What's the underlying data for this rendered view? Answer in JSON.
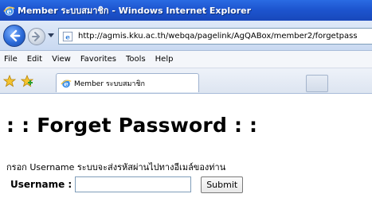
{
  "window": {
    "title": "Member ระบบสมาชิก - Windows Internet Explorer"
  },
  "navigation": {
    "address": "http://agmis.kku.ac.th/webqa/pagelink/AgQABox/member2/forgetpass"
  },
  "menu": {
    "items": [
      "File",
      "Edit",
      "View",
      "Favorites",
      "Tools",
      "Help"
    ]
  },
  "tabs": {
    "active_label": "Member ระบบสมาชิก"
  },
  "page": {
    "heading": ": : Forget Password : :",
    "instruction": "กรอก Username ระบบจะส่งรหัสผ่านไปทางอีเมล์ของท่าน",
    "username_label": "Username :",
    "username_value": "",
    "submit_label": "Submit"
  },
  "icons": {
    "browser": "ie-icon",
    "back": "back-arrow-icon",
    "forward": "forward-arrow-icon",
    "favorites": "star-icon",
    "add_favorite": "add-favorite-icon"
  },
  "colors": {
    "titlebar": "#1d55cf",
    "back_button": "#2b6ad8"
  }
}
